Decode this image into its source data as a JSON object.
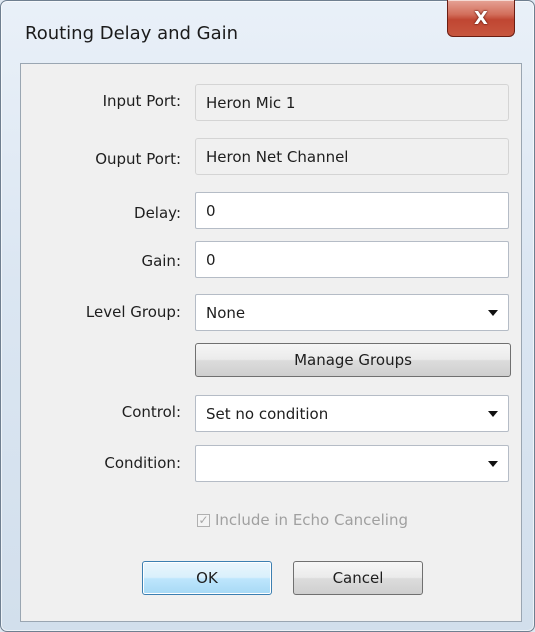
{
  "window": {
    "title": "Routing Delay and Gain",
    "close_glyph": "X"
  },
  "form": {
    "input_port": {
      "label": "Input Port:",
      "value": "Heron Mic 1"
    },
    "output_port": {
      "label": "Ouput Port:",
      "value": "Heron Net Channel"
    },
    "delay": {
      "label": "Delay:",
      "value": "0"
    },
    "gain": {
      "label": "Gain:",
      "value": "0"
    },
    "level_group": {
      "label": "Level Group:",
      "value": "None"
    },
    "manage_groups_label": "Manage Groups",
    "control": {
      "label": "Control:",
      "value": "Set no condition"
    },
    "condition": {
      "label": "Condition:",
      "value": ""
    },
    "echo_canceling": {
      "label": "Include in Echo Canceling",
      "checked": true,
      "enabled": false
    }
  },
  "buttons": {
    "ok": "OK",
    "cancel": "Cancel"
  }
}
